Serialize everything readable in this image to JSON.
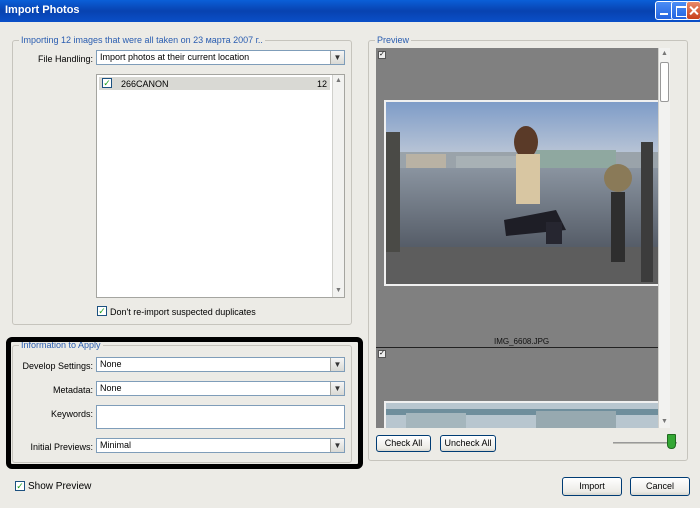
{
  "window": {
    "title": "Import Photos"
  },
  "import_group": {
    "legend": "Importing 12 images that were all taken on 23 марта 2007 г..",
    "file_handling_label": "File Handling:",
    "file_handling_value": "Import photos at their current location",
    "folder": {
      "name": "266CANON",
      "count": "12",
      "checked": true
    },
    "dont_reimport_label": "Don't re-import suspected duplicates"
  },
  "info_group": {
    "legend": "Information to Apply",
    "develop_label": "Develop Settings:",
    "develop_value": "None",
    "metadata_label": "Metadata:",
    "metadata_value": "None",
    "keywords_label": "Keywords:",
    "keywords_value": "",
    "previews_label": "Initial Previews:",
    "previews_value": "Minimal"
  },
  "preview": {
    "legend": "Preview",
    "items": [
      {
        "filename": "IMG_6608.JPG"
      }
    ],
    "check_all": "Check All",
    "uncheck_all": "Uncheck All"
  },
  "footer": {
    "show_preview": "Show Preview",
    "import": "Import",
    "cancel": "Cancel"
  },
  "colors": {
    "titlebar": "#0842b0",
    "legend": "#2a5db0",
    "highlight": "#000000"
  },
  "icons": [
    "minimize-icon",
    "maximize-icon",
    "close-icon",
    "checkmark-icon",
    "chevron-down-icon"
  ]
}
